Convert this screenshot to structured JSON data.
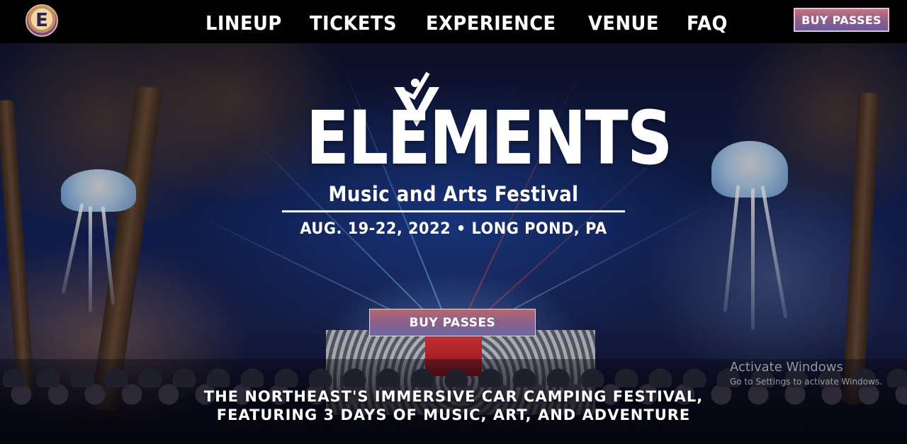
{
  "nav": {
    "logo_letter": "E",
    "links": [
      "LINEUP",
      "TICKETS",
      "EXPERIENCE",
      "VENUE",
      "FAQ"
    ],
    "cta_label": "BUY PASSES"
  },
  "hero": {
    "title": "ELEMENTS",
    "subtitle": "Music and Arts Festival",
    "date_location": "AUG. 19-22, 2022 • LONG POND, PA",
    "cta_label": "BUY PASSES",
    "tagline_line1": "THE NORTHEAST'S IMMERSIVE CAR CAMPING FESTIVAL,",
    "tagline_line2": "FEATURING 3 DAYS OF MUSIC, ART, AND ADVENTURE"
  },
  "os_watermark": {
    "title": "Activate Windows",
    "subtitle": "Go to Settings to activate Windows."
  },
  "colors": {
    "nav_background": "#000000",
    "cta_gradient_top": "#c9707f",
    "cta_gradient_bottom": "#6b5a9e",
    "text": "#ffffff"
  }
}
